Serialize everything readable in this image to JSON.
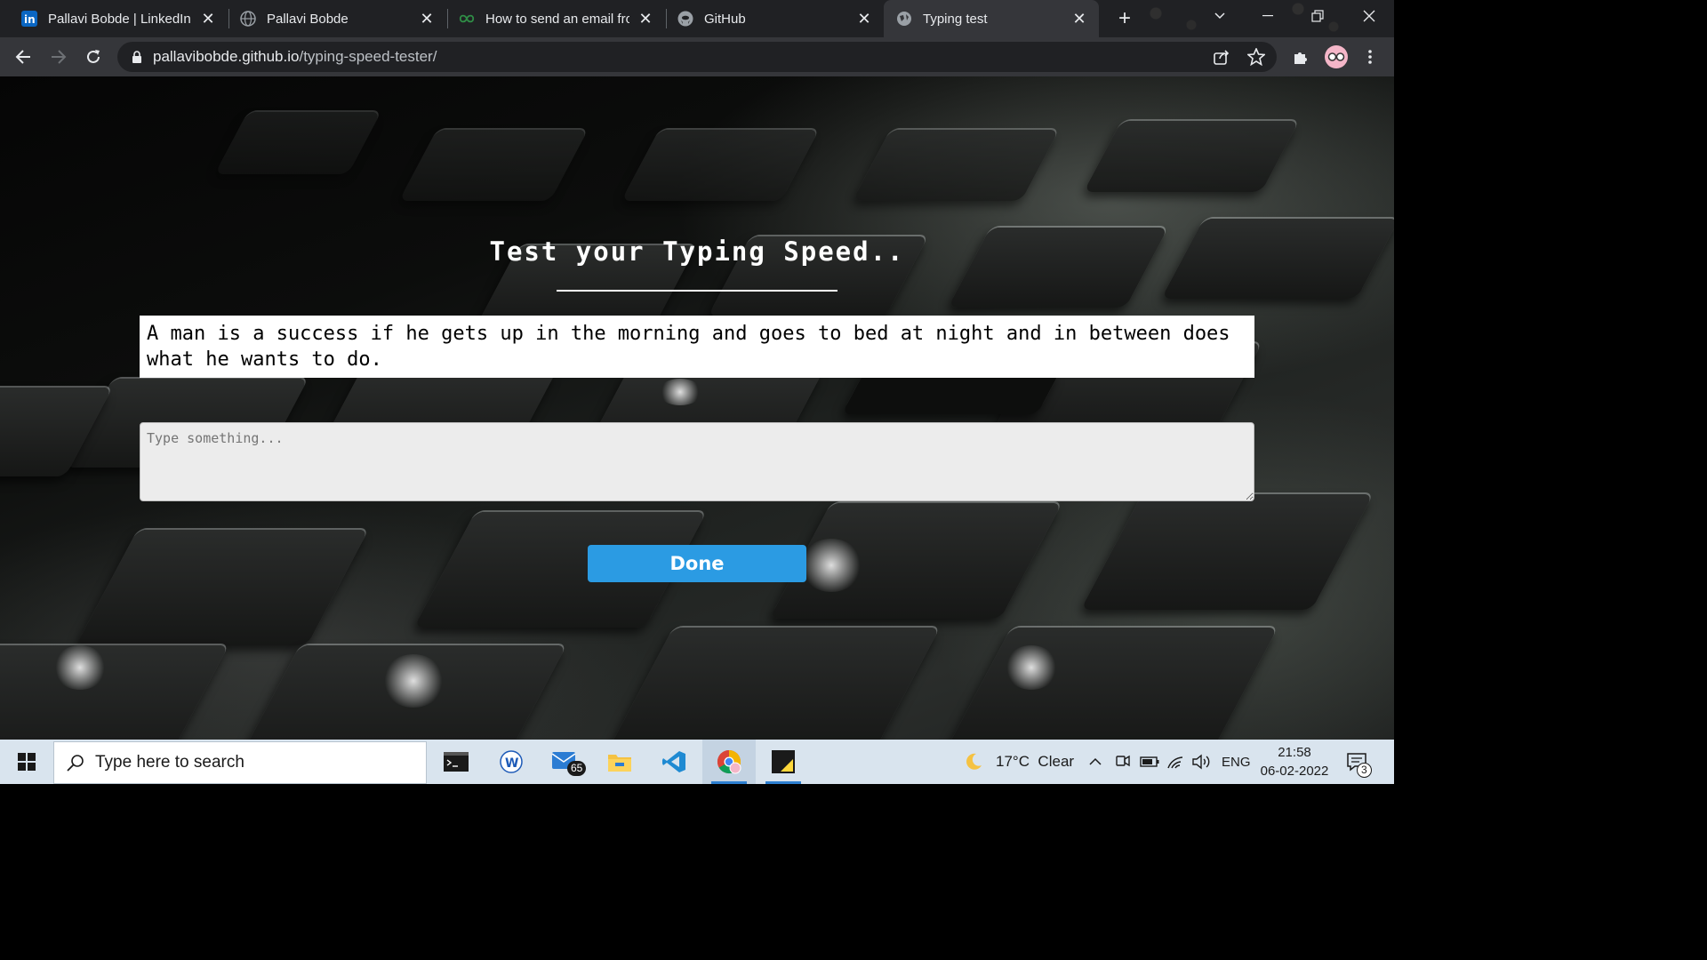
{
  "browser": {
    "tabs": [
      {
        "title": "Pallavi Bobde | LinkedIn",
        "icon": "linkedin-icon",
        "active": false
      },
      {
        "title": "Pallavi Bobde",
        "icon": "globe-icon",
        "active": false
      },
      {
        "title": "How to send an email from",
        "icon": "green-infinity-icon",
        "active": false
      },
      {
        "title": "GitHub",
        "icon": "github-icon",
        "active": false
      },
      {
        "title": "Typing test",
        "icon": "globe-icon",
        "active": true
      }
    ],
    "url_host": "pallavibobde.github.io",
    "url_path": "/typing-speed-tester/"
  },
  "page": {
    "heading": "Test your Typing Speed..",
    "quote": "A man is a success if he gets up in the morning and goes to bed at night and in between does what he wants to do.",
    "input_placeholder": "Type something...",
    "done_label": "Done"
  },
  "taskbar": {
    "search_placeholder": "Type here to search",
    "mail_badge": "65",
    "weather": "17°C  Clear",
    "language": "ENG",
    "time": "21:58",
    "date": "06-02-2022",
    "notification_count": "3"
  },
  "colors": {
    "done_button": "#2b9be3",
    "tab_bg": "#202124",
    "active_tab": "#35363a",
    "taskbar": "#d9e4ee"
  }
}
